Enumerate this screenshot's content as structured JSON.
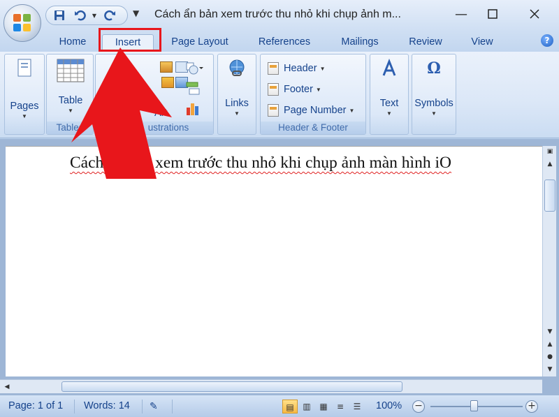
{
  "window": {
    "title": "Cách ẩn bản xem trước thu nhỏ khi chụp ảnh m...",
    "minimize_icon": "minimize-icon",
    "maximize_icon": "maximize-icon",
    "close_icon": "close-icon"
  },
  "quick_access": {
    "icons": [
      "save-icon",
      "undo-icon",
      "redo-icon",
      "customize-qat-icon"
    ]
  },
  "tabs": [
    {
      "label": "Home"
    },
    {
      "label": "Insert",
      "active": true
    },
    {
      "label": "Page Layout"
    },
    {
      "label": "References"
    },
    {
      "label": "Mailings"
    },
    {
      "label": "Review"
    },
    {
      "label": "View"
    }
  ],
  "ribbon": {
    "groups": {
      "pages": {
        "button": "Pages",
        "label": ""
      },
      "tables": {
        "button": "Table",
        "label": "Tables"
      },
      "illustrations": {
        "partial_button": "p",
        "partial_button_2": "Art",
        "label": "ustrations"
      },
      "links": {
        "button": "Links",
        "label": ""
      },
      "header_footer": {
        "header": "Header",
        "footer": "Footer",
        "page_number": "Page Number",
        "label": "Header & Footer"
      },
      "text": {
        "button": "Text",
        "label": ""
      },
      "symbols": {
        "button": "Symbols",
        "label": ""
      }
    }
  },
  "document": {
    "text": "Cách ẩn bản xem trước thu nhỏ khi chụp ảnh màn hình iO"
  },
  "status_bar": {
    "page": "Page: 1 of 1",
    "words": "Words: 14",
    "zoom": "100%",
    "zoom_level_percent": 100
  },
  "colors": {
    "highlight_red": "#e8161b",
    "ribbon_text": "#15428b"
  }
}
